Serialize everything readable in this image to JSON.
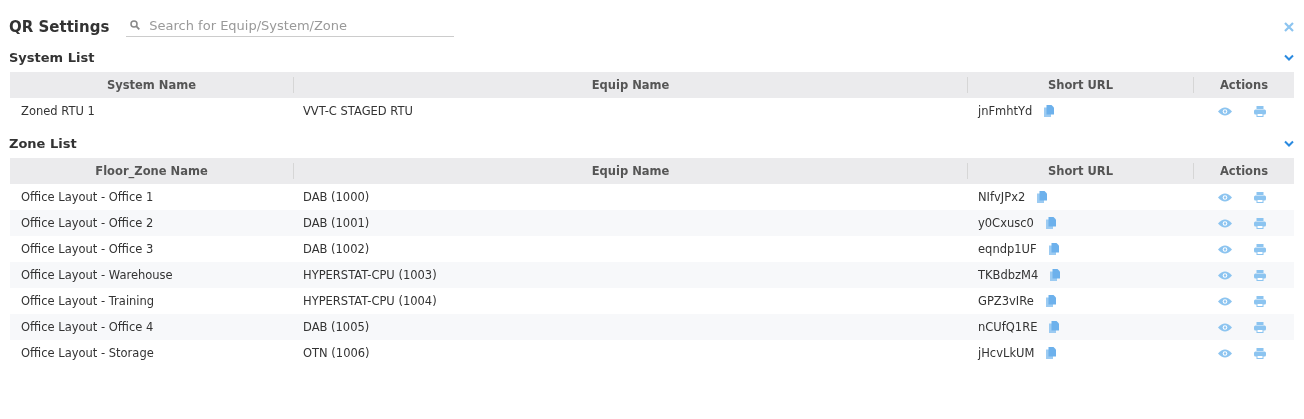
{
  "header": {
    "title": "QR Settings",
    "search": {
      "placeholder": "Search for Equip/System/Zone"
    }
  },
  "sections": [
    {
      "title": "System List",
      "expanded": true,
      "columns": [
        "System Name",
        "Equip Name",
        "Short URL",
        "Actions"
      ],
      "rows": [
        {
          "cells": [
            "Zoned RTU 1",
            "VVT-C STAGED RTU",
            "jnFmhtYd"
          ]
        }
      ]
    },
    {
      "title": "Zone List",
      "expanded": true,
      "columns": [
        "Floor_Zone Name",
        "Equip Name",
        "Short URL",
        "Actions"
      ],
      "rows": [
        {
          "cells": [
            "Office Layout - Office 1",
            "DAB (1000)",
            "NIfvJPx2"
          ]
        },
        {
          "cells": [
            "Office Layout - Office 2",
            "DAB (1001)",
            "y0Cxusc0"
          ]
        },
        {
          "cells": [
            "Office Layout - Office 3",
            "DAB (1002)",
            "eqndp1UF"
          ]
        },
        {
          "cells": [
            "Office Layout - Warehouse",
            "HYPERSTAT-CPU (1003)",
            "TKBdbzM4"
          ]
        },
        {
          "cells": [
            "Office Layout - Training",
            "HYPERSTAT-CPU (1004)",
            "GPZ3vIRe"
          ]
        },
        {
          "cells": [
            "Office Layout - Office 4",
            "DAB (1005)",
            "nCUfQ1RE"
          ]
        },
        {
          "cells": [
            "Office Layout - Storage",
            "OTN (1006)",
            "jHcvLkUM"
          ]
        }
      ]
    }
  ]
}
